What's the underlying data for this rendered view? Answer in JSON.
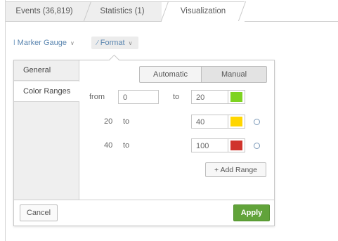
{
  "tabs": {
    "events": "Events (36,819)",
    "statistics": "Statistics (1)",
    "visualization": "Visualization"
  },
  "toolbar": {
    "chart_type": "Marker Gauge",
    "format": "Format"
  },
  "sidebar": {
    "items": [
      {
        "label": "General"
      },
      {
        "label": "Color Ranges"
      }
    ]
  },
  "mode": {
    "automatic": "Automatic",
    "manual": "Manual"
  },
  "ranges": {
    "row1": {
      "from_label": "from",
      "from": "0",
      "to_label": "to",
      "to": "20",
      "color": "#7ed321"
    },
    "row2": {
      "from": "20",
      "to_label": "to",
      "to": "40",
      "color": "#ffd600"
    },
    "row3": {
      "from": "40",
      "to_label": "to",
      "to": "100",
      "color": "#d0342c"
    },
    "add_range": "+ Add Range"
  },
  "footer": {
    "cancel": "Cancel",
    "apply": "Apply"
  }
}
